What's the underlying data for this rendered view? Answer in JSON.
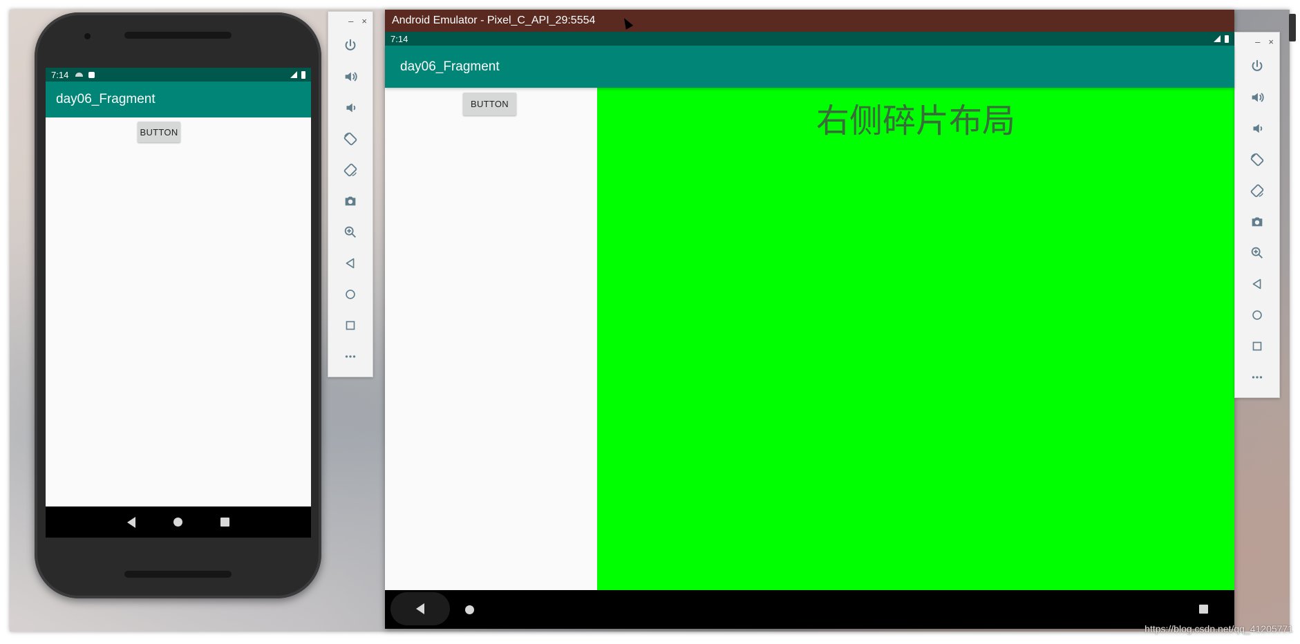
{
  "phone": {
    "status": {
      "time": "7:14"
    },
    "app_title": "day06_Fragment",
    "button_label": "BUTTON"
  },
  "emulator": {
    "window_title": "Android Emulator - Pixel_C_API_29:5554",
    "status": {
      "time": "7:14"
    },
    "app_title": "day06_Fragment",
    "left_fragment": {
      "button_label": "BUTTON"
    },
    "right_fragment": {
      "text": "右侧碎片布局",
      "background": "#00ff00"
    }
  },
  "toolbar": {
    "minimize": "–",
    "close": "×",
    "tools": [
      {
        "icon": "power-icon"
      },
      {
        "icon": "volume-up-icon"
      },
      {
        "icon": "volume-down-icon"
      },
      {
        "icon": "rotate-left-icon"
      },
      {
        "icon": "rotate-right-icon"
      },
      {
        "icon": "camera-icon"
      },
      {
        "icon": "zoom-in-icon"
      },
      {
        "icon": "back-icon"
      },
      {
        "icon": "home-icon"
      },
      {
        "icon": "overview-icon"
      },
      {
        "icon": "more-icon"
      }
    ]
  },
  "watermark": "https://blog.csdn.net/qq_41205771",
  "colors": {
    "status_bar": "#00574b",
    "app_bar": "#008577",
    "emulator_titlebar": "#5a2a21",
    "right_fragment": "#00ff00"
  }
}
